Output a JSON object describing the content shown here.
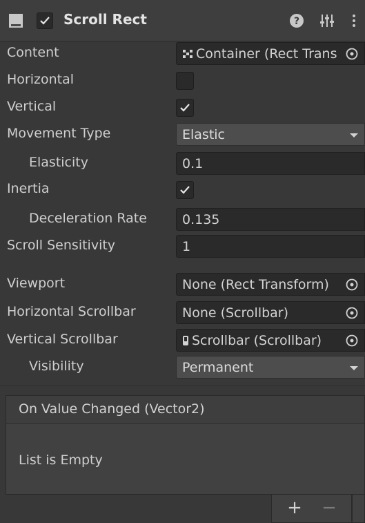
{
  "component": {
    "title": "Scroll Rect",
    "enabled": true,
    "icons": {
      "component": "scrollrect-component-icon",
      "help": "help-icon",
      "preset": "preset-sliders-icon",
      "menu": "kebab-menu-icon"
    }
  },
  "properties": {
    "content": {
      "label": "Content",
      "value": "Container (Rect Transform)"
    },
    "horizontal": {
      "label": "Horizontal",
      "checked": false
    },
    "vertical": {
      "label": "Vertical",
      "checked": true
    },
    "movement_type": {
      "label": "Movement Type",
      "value": "Elastic"
    },
    "elasticity": {
      "label": "Elasticity",
      "value": "0.1"
    },
    "inertia": {
      "label": "Inertia",
      "checked": true
    },
    "deceleration_rate": {
      "label": "Deceleration Rate",
      "value": "0.135"
    },
    "scroll_sensitivity": {
      "label": "Scroll Sensitivity",
      "value": "1"
    },
    "viewport": {
      "label": "Viewport",
      "value": "None (Rect Transform)"
    },
    "horizontal_scrollbar": {
      "label": "Horizontal Scrollbar",
      "value": "None (Scrollbar)"
    },
    "vertical_scrollbar": {
      "label": "Vertical Scrollbar",
      "value": "Scrollbar (Scrollbar)"
    },
    "visibility": {
      "label": "Visibility",
      "value": "Permanent"
    }
  },
  "event": {
    "title": "On Value Changed (Vector2)",
    "empty_text": "List is Empty",
    "add_label": "+",
    "remove_label": "−"
  },
  "colors": {
    "background": "#383838",
    "header": "#3e3e3e",
    "field": "#2a2a2a",
    "dropdown": "#4d4d4d",
    "text": "#d2d2d2"
  }
}
